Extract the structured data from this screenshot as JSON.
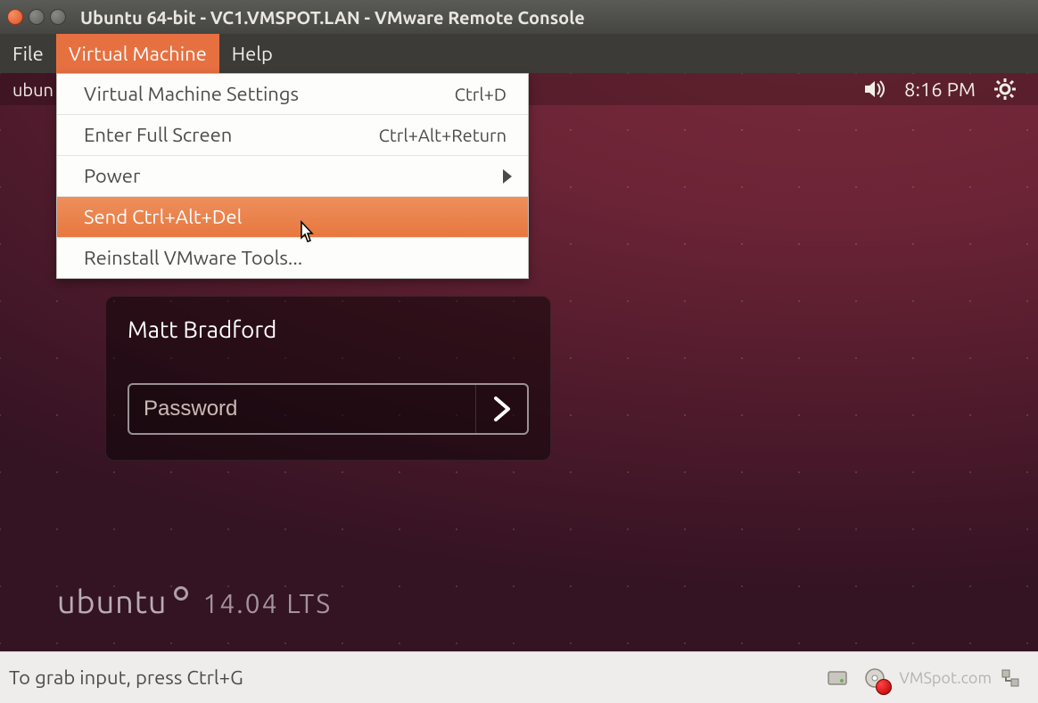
{
  "window": {
    "title": "Ubuntu 64-bit - VC1.VMSPOT.LAN - VMware Remote Console"
  },
  "menubar": {
    "file": "File",
    "virtual_machine": "Virtual Machine",
    "help": "Help"
  },
  "dropdown": {
    "items": [
      {
        "label": "Virtual Machine Settings",
        "shortcut": "Ctrl+D",
        "has_submenu": false
      },
      {
        "label": "Enter Full Screen",
        "shortcut": "Ctrl+Alt+Return",
        "has_submenu": false
      },
      {
        "label": "Power",
        "shortcut": "",
        "has_submenu": true
      },
      {
        "label": "Send Ctrl+Alt+Del",
        "shortcut": "",
        "has_submenu": false
      },
      {
        "label": "Reinstall VMware Tools...",
        "shortcut": "",
        "has_submenu": false
      }
    ],
    "highlighted_index": 3
  },
  "panel": {
    "left_label": "ubun",
    "clock": "8:16 PM"
  },
  "login": {
    "username": "Matt Bradford",
    "password_placeholder": "Password"
  },
  "branding": {
    "name": "ubuntu",
    "version": "14.04 LTS"
  },
  "statusbar": {
    "hint": "To grab input, press Ctrl+G",
    "watermark": "VMSpot.com"
  }
}
